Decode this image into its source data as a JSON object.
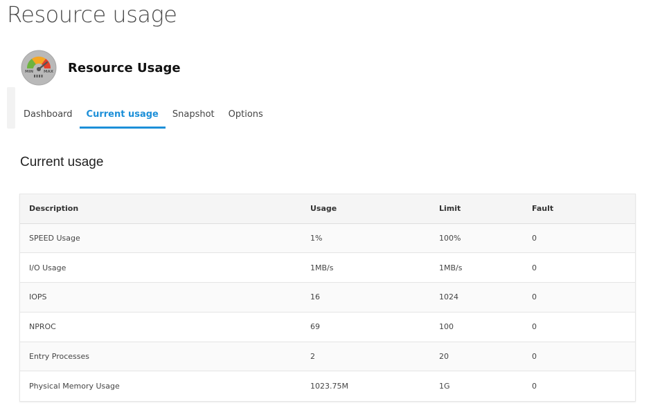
{
  "page": {
    "title": "Resource usage"
  },
  "app": {
    "name": "Resource Usage",
    "icon": "gauge-icon",
    "icon_min_label": "MIN",
    "icon_max_label": "MAX"
  },
  "tabs": [
    {
      "label": "Dashboard",
      "active": false
    },
    {
      "label": "Current usage",
      "active": true
    },
    {
      "label": "Snapshot",
      "active": false
    },
    {
      "label": "Options",
      "active": false
    }
  ],
  "section": {
    "title": "Current usage"
  },
  "table": {
    "columns": [
      "Description",
      "Usage",
      "Limit",
      "Fault"
    ],
    "rows": [
      [
        "SPEED Usage",
        "1%",
        "100%",
        "0"
      ],
      [
        "I/O Usage",
        "1MB/s",
        "1MB/s",
        "0"
      ],
      [
        "IOPS",
        "16",
        "1024",
        "0"
      ],
      [
        "NPROC",
        "69",
        "100",
        "0"
      ],
      [
        "Entry Processes",
        "2",
        "20",
        "0"
      ],
      [
        "Physical Memory Usage",
        "1023.75M",
        "1G",
        "0"
      ]
    ]
  },
  "colors": {
    "accent": "#1c8fd8",
    "header_bg": "#f5f5f5"
  }
}
